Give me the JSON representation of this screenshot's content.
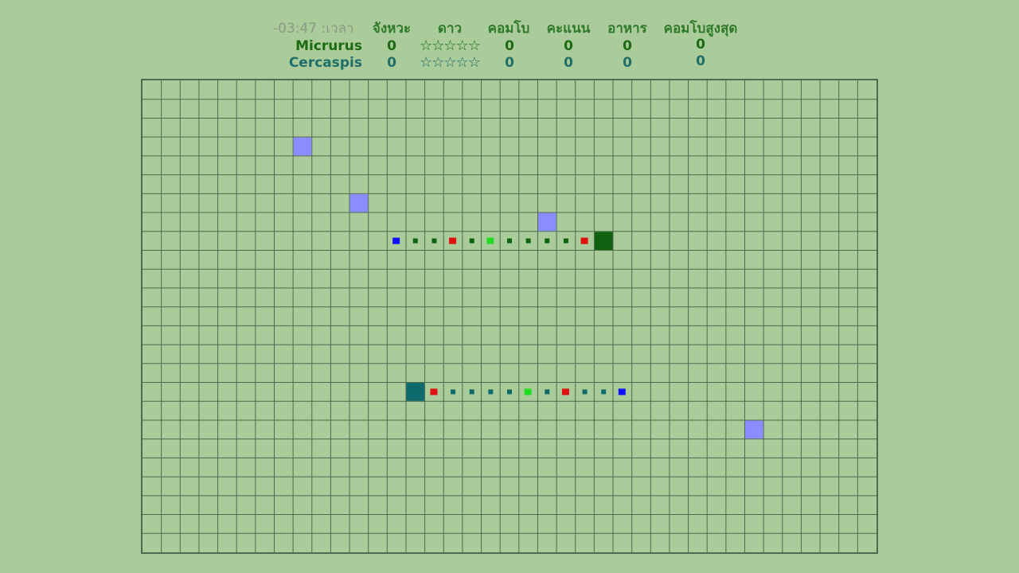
{
  "header": {
    "timer": "-03:47 :เวลา",
    "columns": {
      "rhythm": "จังหวะ",
      "stars": "ดาว",
      "combo": "คอมโบ",
      "score": "คะแนน",
      "food": "อาหาร",
      "max_combo": "คอมโบสูงสุด"
    }
  },
  "players": [
    {
      "name": "Micrurus",
      "rhythm": "0",
      "stars": "☆☆☆☆☆",
      "combo": "0",
      "score": "0",
      "food": "0",
      "max_combo": "0",
      "color": "#1d6b12"
    },
    {
      "name": "Cercaspis",
      "rhythm": "0",
      "stars": "☆☆☆☆☆",
      "combo": "0",
      "score": "0",
      "food": "0",
      "max_combo": "0",
      "color": "#1f6e6a"
    }
  ],
  "board": {
    "cols": 39,
    "rows": 25,
    "background": "#aacb9a",
    "grid_color": "#4f6a4f",
    "food_color": "#8a8cff",
    "food_cells": [
      [
        8,
        3
      ],
      [
        11,
        6
      ],
      [
        21,
        7
      ],
      [
        32,
        18
      ]
    ],
    "snakes": [
      {
        "name": "Micrurus",
        "head": [
          24,
          8
        ],
        "head_color": "#0f6310",
        "direction": "right",
        "tail_col": 13,
        "row": 8,
        "dot_color": "#0f6310",
        "markers": [
          {
            "col": 13,
            "color": "#1010ff"
          },
          {
            "col": 16,
            "color": "#e01010"
          },
          {
            "col": 18,
            "color": "#22dd22"
          },
          {
            "col": 23,
            "color": "#e01010"
          }
        ]
      },
      {
        "name": "Cercaspis",
        "head": [
          14,
          16
        ],
        "head_color": "#0f6b6b",
        "direction": "left",
        "tail_col": 25,
        "row": 16,
        "dot_color": "#0f6b6b",
        "markers": [
          {
            "col": 15,
            "color": "#e01010"
          },
          {
            "col": 20,
            "color": "#22dd22"
          },
          {
            "col": 22,
            "color": "#e01010"
          },
          {
            "col": 25,
            "color": "#1010ff"
          }
        ]
      }
    ]
  }
}
